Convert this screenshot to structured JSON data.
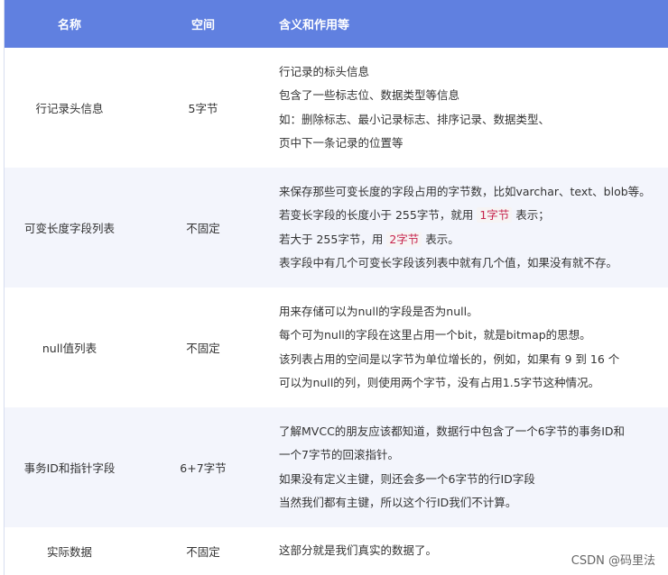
{
  "header": {
    "col1": "名称",
    "col2": "空间",
    "col3": "含义和作用等"
  },
  "rows": [
    {
      "name": "行记录头信息",
      "space": "5字节",
      "lines": [
        [
          {
            "t": "行记录的标头信息"
          }
        ],
        [
          {
            "t": "包含了一些标志位、数据类型等信息"
          }
        ],
        [
          {
            "t": "如：删除标志、最小记录标志、排序记录、数据类型、"
          }
        ],
        [
          {
            "t": "页中下一条记录的位置等"
          }
        ]
      ]
    },
    {
      "name": "可变长度字段列表",
      "space": "不固定",
      "lines": [
        [
          {
            "t": "来保存那些可变长度的字段占用的字节数，比如varchar、text、blob等。"
          }
        ],
        [
          {
            "t": "若变长字段的长度小于 255字节，就用 "
          },
          {
            "t": "1字节",
            "code": true
          },
          {
            "t": " 表示；"
          }
        ],
        [
          {
            "t": "若大于 255字节，用 "
          },
          {
            "t": "2字节",
            "code": true
          },
          {
            "t": " 表示。"
          }
        ],
        [
          {
            "t": "表字段中有几个可变长字段该列表中就有几个值，如果没有就不存。"
          }
        ]
      ]
    },
    {
      "name": "null值列表",
      "space": "不固定",
      "lines": [
        [
          {
            "t": "用来存储可以为null的字段是否为null。"
          }
        ],
        [
          {
            "t": "每个可为null的字段在这里占用一个bit，就是bitmap的思想。"
          }
        ],
        [
          {
            "t": "该列表占用的空间是以字节为单位增长的，例如，如果有 9 到 16 个"
          }
        ],
        [
          {
            "t": "可以为null的列，则使用两个字节，没有占用1.5字节这种情况。"
          }
        ]
      ]
    },
    {
      "name": "事务ID和指针字段",
      "space": "6+7字节",
      "lines": [
        [
          {
            "t": "了解MVCC的朋友应该都知道，数据行中包含了一个6字节的事务ID和"
          }
        ],
        [
          {
            "t": "一个7字节的回滚指针。"
          }
        ],
        [
          {
            "t": "如果没有定义主键，则还会多一个6字节的行ID字段"
          }
        ],
        [
          {
            "t": "当然我们都有主键，所以这个行ID我们不计算。"
          }
        ]
      ]
    },
    {
      "name": "实际数据",
      "space": "不固定",
      "lines": [
        [
          {
            "t": "这部分就是我们真实的数据了。"
          }
        ]
      ]
    }
  ],
  "watermark": "CSDN @码里法"
}
